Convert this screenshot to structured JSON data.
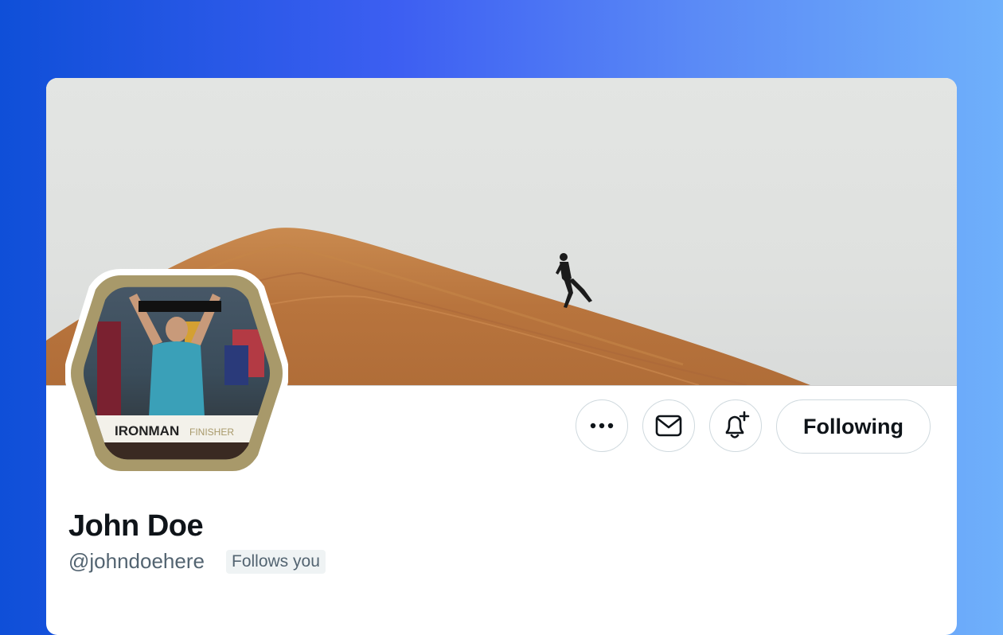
{
  "profile": {
    "name": "John Doe",
    "handle": "@johndoehere",
    "follows_you": "Follows you",
    "avatar_text": {
      "brand": "IRONMAN",
      "tag": "FINISHER"
    }
  },
  "actions": {
    "more": "more-icon",
    "message": "mail-icon",
    "notify": "bell-plus-icon",
    "follow_label": "Following"
  },
  "colors": {
    "accent_bg_left": "#0f4fd8",
    "accent_bg_right": "#6fb0fb",
    "text_primary": "#0f1419",
    "text_secondary": "#536471",
    "border": "#cfd9de",
    "avatar_frame": "#a8996a"
  }
}
